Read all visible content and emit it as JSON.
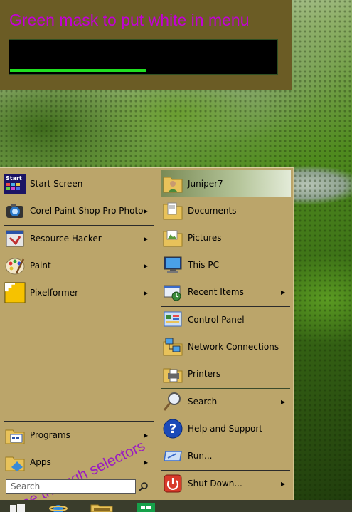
{
  "mask_panel": {
    "title": "Green mask to put white in menu",
    "progress_fraction": 0.51
  },
  "start_menu": {
    "left_items": [
      {
        "label": "Start Screen",
        "icon": "start-screen-icon",
        "arrow": false
      },
      {
        "label": "Corel Paint Shop Pro Photo",
        "icon": "camera-icon",
        "arrow": true
      },
      {
        "label": "Resource Hacker",
        "icon": "resource-hacker-icon",
        "arrow": true
      },
      {
        "label": "Paint",
        "icon": "paint-palette-icon",
        "arrow": true
      },
      {
        "label": "Pixelformer",
        "icon": "pixelformer-icon",
        "arrow": true
      }
    ],
    "bottom_left_items": [
      {
        "label": "Programs",
        "icon": "programs-folder-icon",
        "arrow": true
      },
      {
        "label": "Apps",
        "icon": "apps-folder-icon",
        "arrow": true
      }
    ],
    "search_placeholder": "Search",
    "right_items": [
      {
        "label": "Juniper7",
        "icon": "user-folder-icon",
        "arrow": false
      },
      {
        "label": "Documents",
        "icon": "documents-icon",
        "arrow": false
      },
      {
        "label": "Pictures",
        "icon": "pictures-icon",
        "arrow": false
      },
      {
        "label": "This PC",
        "icon": "this-pc-icon",
        "arrow": false
      },
      {
        "label": "Recent Items",
        "icon": "recent-items-icon",
        "arrow": true
      },
      {
        "label": "Control Panel",
        "icon": "control-panel-icon",
        "arrow": false
      },
      {
        "label": "Network Connections",
        "icon": "network-icon",
        "arrow": false
      },
      {
        "label": "Printers",
        "icon": "printers-icon",
        "arrow": false
      },
      {
        "label": "Search",
        "icon": "search-magnifier-icon",
        "arrow": true
      },
      {
        "label": "Help and Support",
        "icon": "help-icon",
        "arrow": false
      },
      {
        "label": "Run...",
        "icon": "run-icon",
        "arrow": false
      },
      {
        "label": "Shut Down...",
        "icon": "shutdown-icon",
        "arrow": true
      }
    ],
    "overlay_note": "See through selectors"
  },
  "colors": {
    "menu_bg": "#bba56a",
    "mask_panel_bg": "#6b5c25",
    "mask_title": "#c400d6",
    "progress": "#21e021",
    "overlay_text": "#9a1bc2"
  }
}
